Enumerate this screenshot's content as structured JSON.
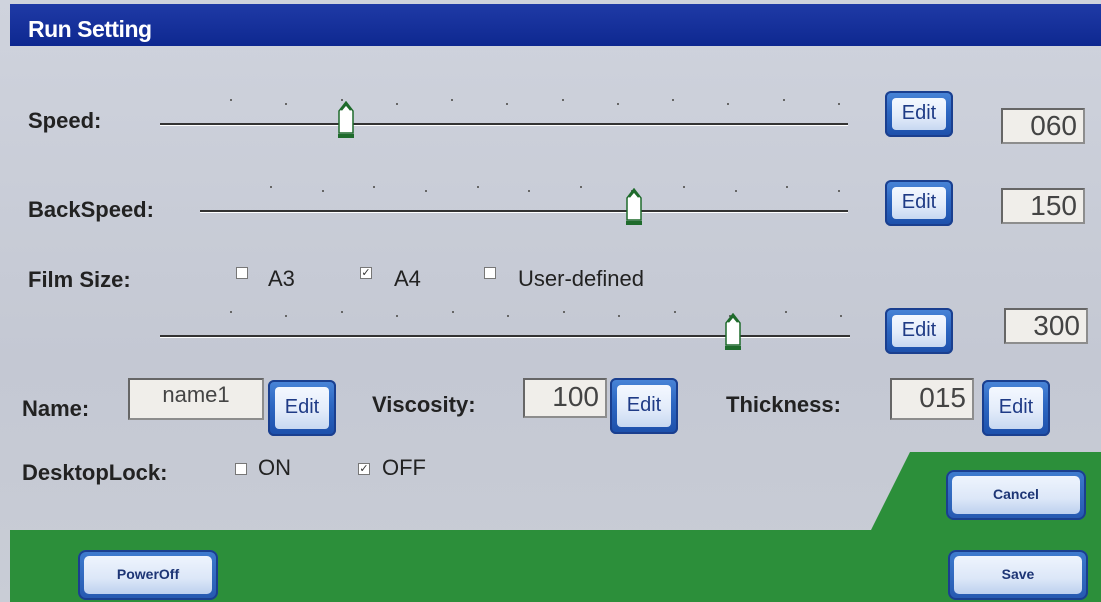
{
  "window": {
    "title": "Run Setting"
  },
  "speed": {
    "label": "Speed:",
    "edit_label": "Edit",
    "value": "060",
    "slider_fraction": 0.27
  },
  "back_speed": {
    "label": "BackSpeed:",
    "edit_label": "Edit",
    "value": "150",
    "slider_fraction": 0.67
  },
  "film_size": {
    "label": "Film Size:",
    "options": [
      {
        "label": "A3",
        "checked": false
      },
      {
        "label": "A4",
        "checked": true
      },
      {
        "label": "User-defined",
        "checked": false
      }
    ],
    "edit_label": "Edit",
    "value": "300",
    "slider_fraction": 0.83
  },
  "name": {
    "label": "Name:",
    "value": "name1",
    "edit_label": "Edit"
  },
  "viscosity": {
    "label": "Viscosity:",
    "value": "100",
    "edit_label": "Edit"
  },
  "thickness": {
    "label": "Thickness:",
    "value": "015",
    "edit_label": "Edit"
  },
  "desktop_lock": {
    "label": "DesktopLock:",
    "options": [
      {
        "label": "ON",
        "checked": false
      },
      {
        "label": "OFF",
        "checked": true
      }
    ]
  },
  "buttons": {
    "cancel": "Cancel",
    "save": "Save",
    "power_off": "PowerOff"
  },
  "colors": {
    "title_bar": "#0e2890",
    "accent_green": "#2c8f3a",
    "button_blue": "#2558b0"
  }
}
